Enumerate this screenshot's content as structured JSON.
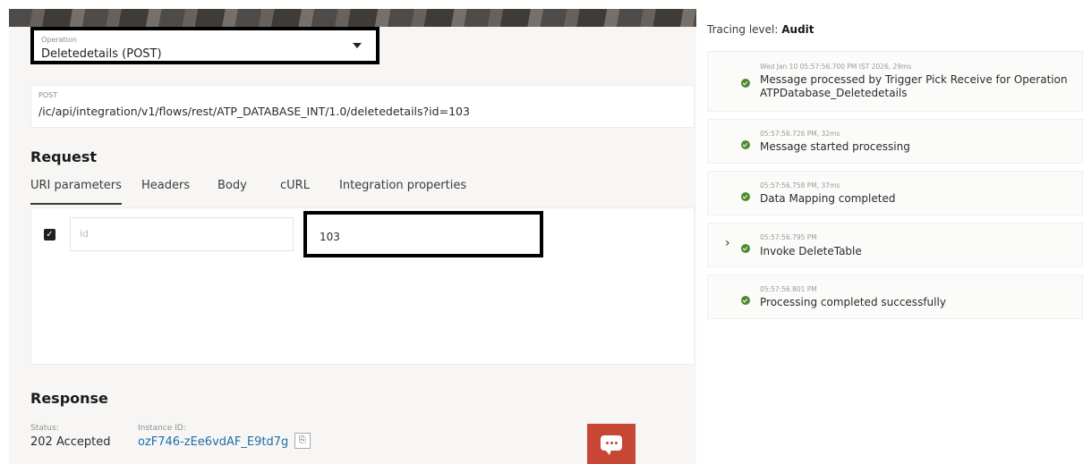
{
  "operation": {
    "label": "Operation",
    "value": "Deletedetails (POST)"
  },
  "endpoint": {
    "method": "POST",
    "url": "/ic/api/integration/v1/flows/rest/ATP_DATABASE_INT/1.0/deletedetails?id=103"
  },
  "request": {
    "heading": "Request",
    "tabs": [
      "URI parameters",
      "Headers",
      "Body",
      "cURL",
      "Integration properties"
    ],
    "active_tab": "URI parameters",
    "param": {
      "checked": true,
      "name": "id",
      "value": "103"
    }
  },
  "response": {
    "heading": "Response",
    "status_label": "Status:",
    "status_value": "202 Accepted",
    "instance_label": "Instance ID:",
    "instance_value": "ozF746-zEe6vdAF_E9td7g"
  },
  "tracing": {
    "label": "Tracing level:",
    "level": "Audit",
    "events": [
      {
        "time": "Wed Jan 10 05:57:56.700 PM IST 2026, 29ms",
        "line1": "Message processed by Trigger Pick Receive for Operation",
        "line2": "ATPDatabase_Deletedetails",
        "status": "success",
        "expandable": false
      },
      {
        "time": "05:57:56.726 PM, 32ms",
        "line1": "Message started processing",
        "line2": "",
        "status": "success",
        "expandable": false
      },
      {
        "time": "05:57:56.758 PM, 37ms",
        "line1": "Data Mapping completed",
        "line2": "",
        "status": "success",
        "expandable": false
      },
      {
        "time": "05:57:56.795 PM",
        "line1": "Invoke DeleteTable",
        "line2": "",
        "status": "success",
        "expandable": true
      },
      {
        "time": "05:57:56.801 PM",
        "line1": "Processing completed successfully",
        "line2": "",
        "status": "success",
        "expandable": false
      }
    ]
  },
  "colors": {
    "accent": "#c74634",
    "success": "#4f8a2f",
    "link": "#1d6fa5"
  },
  "icons": [
    "chevron-down-icon",
    "checkbox-checked-icon",
    "copy-icon",
    "chat-icon",
    "success-check-icon",
    "chevron-right-icon"
  ]
}
